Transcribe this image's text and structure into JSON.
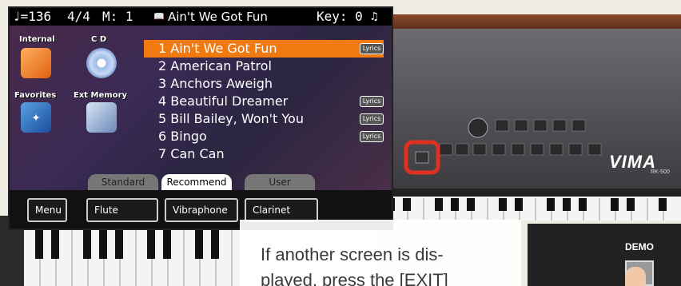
{
  "status_bar": {
    "tempo": "♩=136",
    "meter": "4/4",
    "measure": "M:  1",
    "song_title": "Ain't We Got Fun",
    "key": "Key: 0"
  },
  "categories": {
    "internal": "Internal",
    "cd": "C D",
    "favorites": "Favorites",
    "ext_memory": "Ext Memory"
  },
  "songs": [
    {
      "label": "1 Ain't We Got Fun",
      "lyrics": "Lyrics"
    },
    {
      "label": "2 American Patrol",
      "lyrics": ""
    },
    {
      "label": "3 Anchors Aweigh",
      "lyrics": ""
    },
    {
      "label": "4 Beautiful Dreamer",
      "lyrics": "Lyrics"
    },
    {
      "label": "5 Bill Bailey, Won't You",
      "lyrics": "Lyrics"
    },
    {
      "label": "6 Bingo",
      "lyrics": "Lyrics"
    },
    {
      "label": "7 Can Can",
      "lyrics": ""
    }
  ],
  "tabs": {
    "standard": "Standard",
    "recommend": "Recommend",
    "user": "User"
  },
  "soft_buttons": {
    "menu": "Menu",
    "flute": "Flute",
    "vibraphone": "Vibraphone",
    "clarinet": "Clarinet"
  },
  "instrument": {
    "brand": "VIMA",
    "model": "RK-500",
    "demo_label": "DEMO"
  },
  "callout": {
    "line1": "If another screen is dis-",
    "line2": "played, press the [EXIT]"
  },
  "colors": {
    "selection": "#f07a10",
    "highlight_ring": "#e03020",
    "lcd_bg": "#3a2a55"
  }
}
